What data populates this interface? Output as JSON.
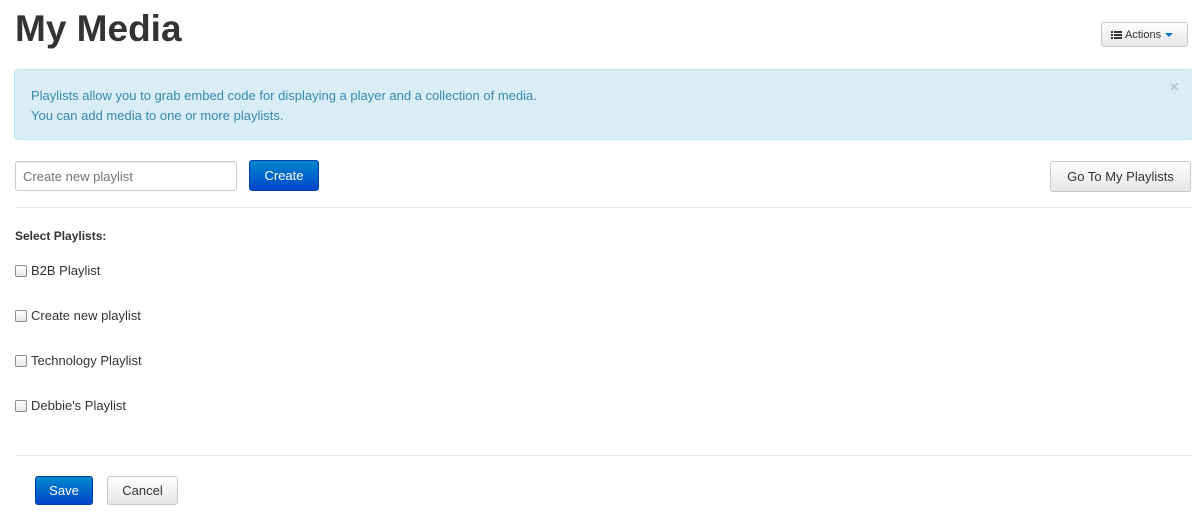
{
  "header": {
    "title": "My Media",
    "actions_label": "Actions",
    "actions_icon": "list-icon"
  },
  "alert": {
    "line1": "Playlists allow you to grab embed code for displaying a player and a collection of media.",
    "line2": "You can add media to one or more playlists.",
    "close_label": "×"
  },
  "create_form": {
    "input_value": "",
    "input_placeholder": "Create new playlist",
    "create_label": "Create",
    "goto_label": "Go To My Playlists"
  },
  "playlists": {
    "heading": "Select Playlists:",
    "items": [
      {
        "label": "B2B Playlist",
        "checked": false
      },
      {
        "label": "Create new playlist",
        "checked": false
      },
      {
        "label": "Technology Playlist",
        "checked": false
      },
      {
        "label": "Debbie's Playlist",
        "checked": false
      }
    ]
  },
  "footer": {
    "save_label": "Save",
    "cancel_label": "Cancel"
  },
  "colors": {
    "primary": "#0074cc",
    "alert_bg": "#d9edf7",
    "alert_text": "#3a87ad"
  }
}
